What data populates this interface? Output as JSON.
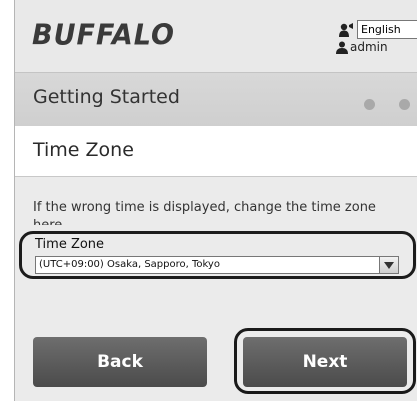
{
  "header": {
    "logo_text": "BUFFALO",
    "language_selected": "English",
    "user_name": "admin"
  },
  "titlebar": {
    "title": "Getting Started"
  },
  "section": {
    "title": "Time Zone"
  },
  "content": {
    "info_text": "If the wrong time is displayed, change the time zone here.",
    "timezone_label": "Time Zone",
    "timezone_selected": "(UTC+09:00) Osaka, Sapporo, Tokyo"
  },
  "buttons": {
    "back_label": "Back",
    "next_label": "Next"
  },
  "icons": {
    "language": "language-speaker-icon",
    "user": "user-icon",
    "dropdown": "chevron-down-icon"
  }
}
